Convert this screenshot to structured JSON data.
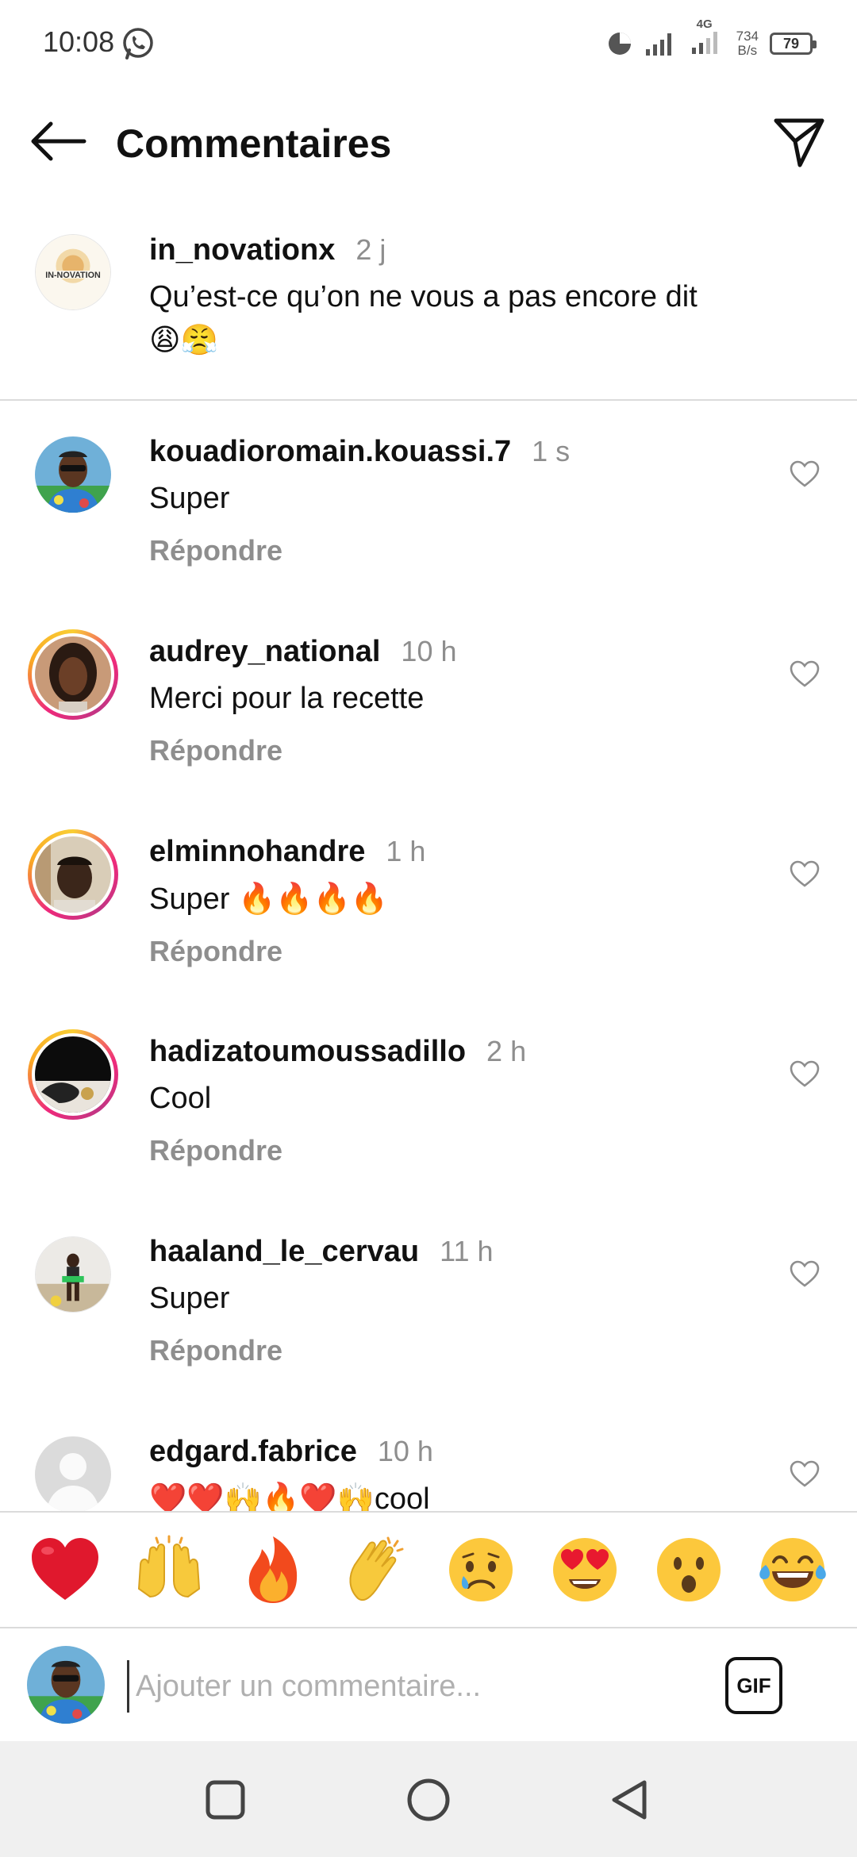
{
  "status_bar": {
    "time": "10:08",
    "network": "4G",
    "speed_value": "734",
    "speed_unit": "B/s",
    "battery": "79"
  },
  "header": {
    "title": "Commentaires"
  },
  "caption": {
    "username": "in_novationx",
    "time": "2 j",
    "text": "Qu’est-ce qu’on ne vous a pas encore dit",
    "emojis": "😩😤",
    "avatar_logo": "IN-NOVATION"
  },
  "comments": [
    {
      "username": "kouadioromain.kouassi.7",
      "time": "1 s",
      "text": "Super",
      "emojis": "",
      "reply": "Répondre"
    },
    {
      "username": "audrey_national",
      "time": "10 h",
      "text": "Merci pour la recette",
      "emojis": "",
      "reply": "Répondre"
    },
    {
      "username": "elminnohandre",
      "time": "1 h",
      "text": "Super ",
      "emojis": "🔥🔥🔥🔥",
      "reply": "Répondre"
    },
    {
      "username": "hadizatoumoussadillo",
      "time": "2 h",
      "text": "Cool",
      "emojis": "",
      "reply": "Répondre"
    },
    {
      "username": "haaland_le_cervau",
      "time": "11 h",
      "text": "Super",
      "emojis": "",
      "reply": "Répondre"
    },
    {
      "username": "edgard.fabrice",
      "time": "10 h",
      "text": "cool",
      "emojis": "❤️❤️🙌🔥❤️🙌",
      "reply": ""
    }
  ],
  "emoji_bar": [
    "❤️",
    "🙌",
    "🔥",
    "👏",
    "😢",
    "😍",
    "😮",
    "😂"
  ],
  "input": {
    "placeholder": "Ajouter un commentaire...",
    "gif_label": "GIF"
  },
  "icons": {
    "back": "arrow-left-icon",
    "send": "paper-plane-icon",
    "like": "heart-outline-icon"
  }
}
